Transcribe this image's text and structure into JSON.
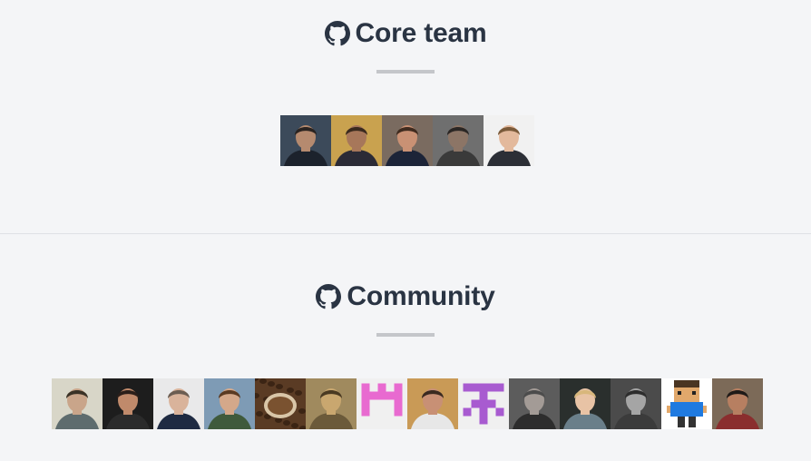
{
  "core": {
    "title": "Core team",
    "members": [
      {
        "name": "core-avatar-1",
        "bg": "#3c4a5a",
        "skin": "#b58a6f",
        "hair": "#2a2320",
        "shirt": "#1c222c"
      },
      {
        "name": "core-avatar-2",
        "bg": "#c9a24f",
        "skin": "#a7775a",
        "hair": "#3a2a1e",
        "shirt": "#2b2b36"
      },
      {
        "name": "core-avatar-3",
        "bg": "#7a6b60",
        "skin": "#c99174",
        "hair": "#3f2b1f",
        "shirt": "#1c2438"
      },
      {
        "name": "core-avatar-4",
        "bg": "#6f6f6f",
        "skin": "#8c7566",
        "hair": "#2a2624",
        "shirt": "#3a3a3a"
      },
      {
        "name": "core-avatar-5",
        "bg": "#f1f1f1",
        "skin": "#e3b99c",
        "hair": "#7a5a3a",
        "shirt": "#2c2f36"
      }
    ]
  },
  "community": {
    "title": "Community",
    "members": [
      {
        "name": "community-avatar-1",
        "kind": "photo",
        "bg": "#d8d6c8",
        "skin": "#c9a58a",
        "hair": "#3a3226",
        "shirt": "#5e6c6e"
      },
      {
        "name": "community-avatar-2",
        "kind": "photo",
        "bg": "#1d1d1d",
        "skin": "#c08a6b",
        "hair": "#2b1f1a",
        "shirt": "#2b2b2b"
      },
      {
        "name": "community-avatar-3",
        "kind": "photo",
        "bg": "#e9e9ea",
        "skin": "#d9b39b",
        "hair": "#6b5d52",
        "shirt": "#1e2a42"
      },
      {
        "name": "community-avatar-4",
        "kind": "photo",
        "bg": "#7e9bb5",
        "skin": "#d4a88a",
        "hair": "#5a3a22",
        "shirt": "#3f5a3c"
      },
      {
        "name": "community-avatar-5",
        "kind": "coffee",
        "bg": "#5a3b24",
        "skin": "#d9c6a8",
        "hair": "#3a2515",
        "shirt": "#7a5230"
      },
      {
        "name": "community-avatar-6",
        "kind": "photo",
        "bg": "#a08a5e",
        "skin": "#c9a76f",
        "hair": "#4a3a22",
        "shirt": "#6b5a3a"
      },
      {
        "name": "community-avatar-7",
        "kind": "identicon",
        "bg": "#f0f0f0",
        "color": "#e86ad0",
        "pattern": [
          [
            1,
            0,
            1,
            0,
            1
          ],
          [
            1,
            1,
            1,
            1,
            1
          ],
          [
            1,
            0,
            0,
            0,
            1
          ],
          [
            1,
            0,
            0,
            0,
            1
          ],
          [
            0,
            0,
            0,
            0,
            0
          ]
        ]
      },
      {
        "name": "community-avatar-8",
        "kind": "photo",
        "bg": "#c99a56",
        "skin": "#c89075",
        "hair": "#3a2a20",
        "shirt": "#e7e7e7"
      },
      {
        "name": "community-avatar-9",
        "kind": "identicon",
        "bg": "#f0f0f0",
        "color": "#a85bd0",
        "pattern": [
          [
            1,
            1,
            1,
            1,
            1
          ],
          [
            0,
            0,
            1,
            0,
            0
          ],
          [
            0,
            1,
            1,
            1,
            0
          ],
          [
            1,
            0,
            1,
            0,
            1
          ],
          [
            0,
            0,
            1,
            0,
            0
          ]
        ]
      },
      {
        "name": "community-avatar-10",
        "kind": "photo",
        "bg": "#5c5c5c",
        "skin": "#a39b96",
        "hair": "#4c4c4c",
        "shirt": "#2d2d2d"
      },
      {
        "name": "community-avatar-11",
        "kind": "photo",
        "bg": "#2a2f2d",
        "skin": "#e8c3a5",
        "hair": "#d8b77c",
        "shirt": "#6a7f8a"
      },
      {
        "name": "community-avatar-12",
        "kind": "photo",
        "bg": "#4b4b4b",
        "skin": "#a5a5a5",
        "hair": "#2d2d2d",
        "shirt": "#3b3b3b"
      },
      {
        "name": "community-avatar-13",
        "kind": "pixel",
        "bg": "#ffffff",
        "skin": "#e1a86b",
        "hair": "#4a3522",
        "shirt": "#1f7ae0"
      },
      {
        "name": "community-avatar-14",
        "kind": "photo",
        "bg": "#7c6a58",
        "skin": "#b77f61",
        "hair": "#1f1a18",
        "shirt": "#8a2e2e"
      }
    ]
  }
}
